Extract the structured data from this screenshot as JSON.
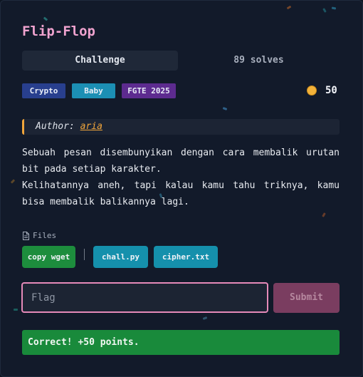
{
  "challenge": {
    "title": "Flip-Flop",
    "tabs": [
      {
        "label": "Challenge",
        "active": true
      },
      {
        "label": "89 solves",
        "active": false
      }
    ],
    "tags": [
      {
        "label": "Crypto",
        "color": "#283f8e"
      },
      {
        "label": "Baby",
        "color": "#1c8fb4"
      },
      {
        "label": "FGTE 2025",
        "color": "#5d2b8f"
      }
    ],
    "points": "50",
    "author_label": "Author:",
    "author_name": "aria",
    "description": [
      "Sebuah pesan disembunyikan dengan cara membalik urutan bit pada setiap karakter.",
      "Kelihatannya aneh, tapi kalau kamu tahu triknya, kamu bisa membalik balikannya lagi."
    ],
    "files_label": "Files",
    "file_buttons": [
      {
        "label": "copy wget",
        "color": "#1d8d3d"
      },
      {
        "label": "chall.py",
        "color": "#1590ac"
      },
      {
        "label": "cipher.txt",
        "color": "#1590ac"
      }
    ],
    "flag_placeholder": "Flag",
    "submit_label": "Submit",
    "result_message": "Correct! +50 points."
  },
  "colors": {
    "title": "#f0a3cf",
    "accent_pink": "#e68ab9",
    "author_accent": "#f0a53b",
    "success": "#198a3b"
  },
  "icons": [
    "coin-icon",
    "file-icon"
  ]
}
